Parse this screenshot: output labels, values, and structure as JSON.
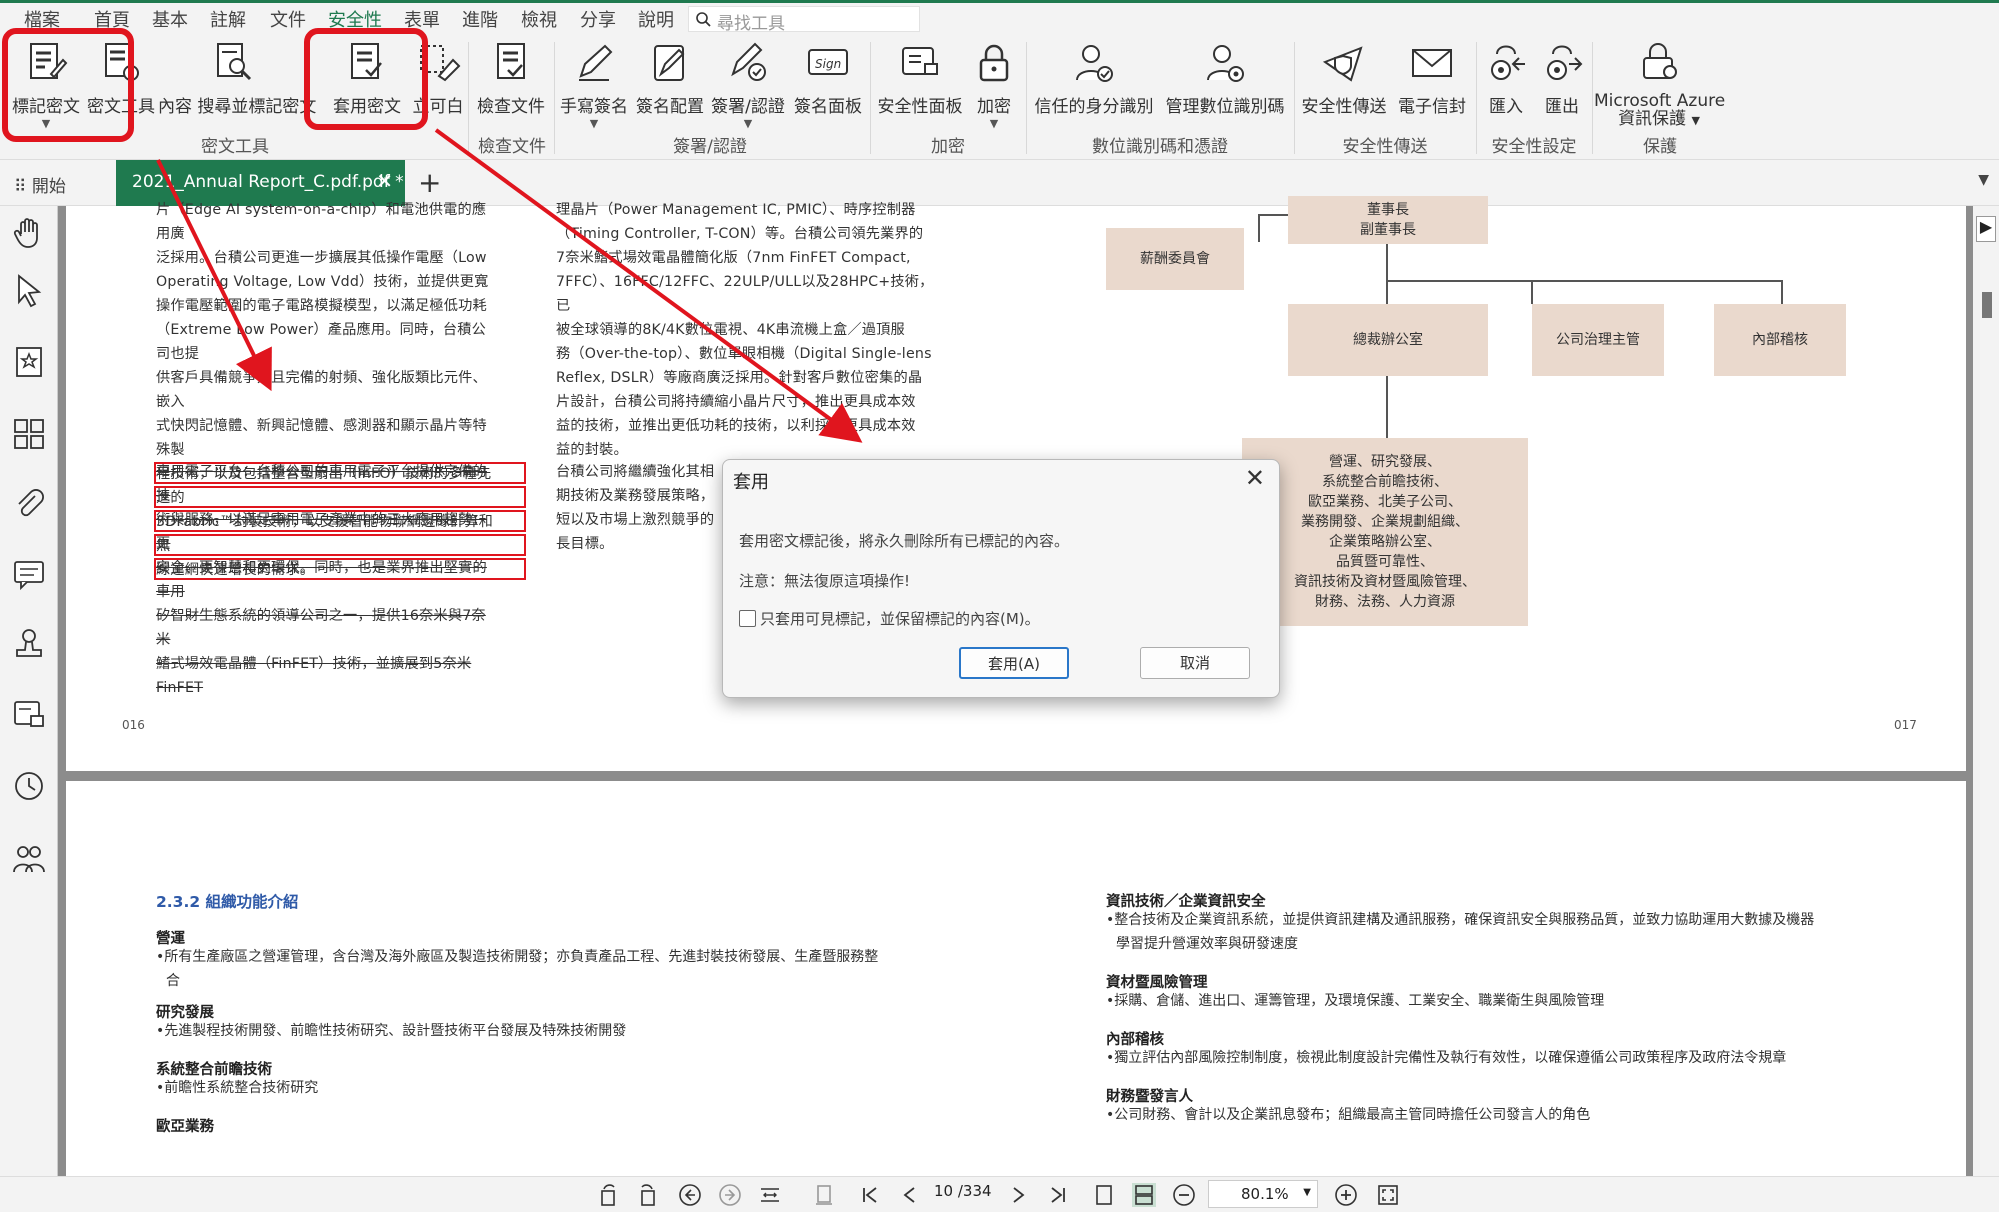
{
  "menu": [
    "檔案",
    "首頁",
    "基本",
    "註解",
    "文件",
    "安全性",
    "表單",
    "進階",
    "檢視",
    "分享",
    "說明"
  ],
  "search_placeholder": "尋找工具",
  "ribbon": {
    "buttons": {
      "mark": "標記密文",
      "redact_tools": "密文工具",
      "search_redact": "內容 搜尋並標記密文",
      "apply": "套用密文",
      "whiteout": "立可白",
      "inspect": "檢查文件",
      "handsign": "手寫簽名",
      "sign_config": "簽名配置",
      "sign_cert": "簽署/認證",
      "sign_panel": "簽名面板",
      "security_panel": "安全性面板",
      "encrypt": "加密",
      "trusted_ids": "信任的身分識別",
      "manage_ids": "管理數位識別碼",
      "secure_send": "安全性傳送",
      "email_sign": "電子信封",
      "import": "匯入",
      "export": "匯出",
      "azure1": "Microsoft Azure",
      "azure2": "資訊保護"
    },
    "groups": {
      "redact": "密文工具",
      "inspect": "檢查文件",
      "sign": "簽署/認證",
      "encrypt": "加密",
      "digital_id": "數位識別碼和憑證",
      "secure_send": "安全性傳送",
      "security_settings": "安全性設定",
      "protect": "保護"
    }
  },
  "tabs": {
    "start": "開始",
    "doc": "2021_Annual Report_C.pdf.pdf *"
  },
  "page1": {
    "left_col": [
      "片（Edge AI system-on-a-chip）和電池供電的應用廣",
      "泛採用。台積公司更進一步擴展其低操作電壓（Low",
      "Operating Voltage, Low Vdd）技術，並提供更寬",
      "操作電壓範圍的電子電路模擬模型，以滿足極低功耗",
      "（Extreme Low Power）產品應用。同時，台積公司也提",
      "供客戶具備競爭力且完備的射頻、強化版類比元件、嵌入",
      "式快閃記憶體、新興記憶體、感測器和顯示晶片等特殊製",
      "程技術，以及包括整合型扇出（InFO）技術的多種先進的",
      "3DFabric™封裝技術，以支援智能物聯網邊緣計算和無",
      "線連網快速增長的需求。"
    ],
    "left_redacted": [
      "車用電子平台：台積公司的車用電子平台提供完備的技",
      "術與服務，以滿足車用電子產業中的三大應用趨勢：更",
      "安全、更智慧和更環保。同時，也是業界推出堅實的車用",
      "矽智財生態系統的領導公司之一，提供16奈米與7奈米",
      "鰭式場效電晶體（FinFET）技術，並擴展到5奈米FinFET"
    ],
    "mid_col": [
      "理晶片（Power Management IC, PMIC）、時序控制器",
      "（Timing Controller, T-CON）等。台積公司領先業界的",
      "7奈米鰭式場效電晶體簡化版（7nm FinFET Compact,",
      "7FFC）、16FFC/12FFC、22ULP/ULL以及28HPC+技術，已",
      "被全球領導的8K/4K數位電視、4K串流機上盒／過頂服",
      "務（Over-the-top）、數位單眼相機（Digital Single-lens",
      "Reflex, DSLR）等廠商廣泛採用。針對客戶數位密集的晶",
      "片設計，台積公司將持續縮小晶片尺寸，推出更具成本效",
      "益的技術，並推出更低功耗的技術，以利採用更具成本效",
      "益的封裝。"
    ],
    "mid_col2": [
      "台積公司將繼續強化其相",
      "期技術及業務發展策略，",
      "短以及市場上激烈競爭的",
      "長目標。"
    ],
    "page_left": "016",
    "page_right": "017",
    "org": {
      "chair": "董事長\n副董事長",
      "comp": "薪酬委員會",
      "ceo": "總裁辦公室",
      "gov": "公司治理主管",
      "audit": "內部稽核",
      "ops": "營運、研究發展、\n系統整合前瞻技術、\n歐亞業務、北美子公司、\n業務開發、企業規劃組織、\n企業策略辦公室、\n品質暨可靠性、\n資訊技術及資材暨風險管理、\n財務、法務、人力資源"
    }
  },
  "dialog": {
    "title": "套用",
    "msg": "套用密文標記後，將永久刪除所有已標記的內容。",
    "warn": "注意：無法復原這項操作!",
    "check": "只套用可見標記，並保留標記的內容(M)。",
    "apply": "套用(A)",
    "cancel": "取消"
  },
  "page2": {
    "heading": "2.3.2 組織功能介紹",
    "left": [
      {
        "title": "營運",
        "text": "•所有生產廠區之營運管理，含台灣及海外廠區及製造技術開發；亦負責產品工程、先進封裝技術發展、生產暨服務整",
        "text2": "合"
      },
      {
        "title": "研究發展",
        "text": "•先進製程技術開發、前瞻性技術研究、設計暨技術平台發展及特殊技術開發",
        "text2": ""
      },
      {
        "title": "系統整合前瞻技術",
        "text": "•前瞻性系統整合技術研究",
        "text2": ""
      },
      {
        "title": "歐亞業務",
        "text": "",
        "text2": ""
      }
    ],
    "right": [
      {
        "title": "資訊技術／企業資訊安全",
        "text": "•整合技術及企業資訊系統，並提供資訊建構及通訊服務，確保資訊安全與服務品質，並致力協助運用大數據及機器",
        "text2": "學習提升營運效率與研發速度"
      },
      {
        "title": "資材暨風險管理",
        "text": "•採購、倉儲、進出口、運籌管理，及環境保護、工業安全、職業衛生與風險管理",
        "text2": ""
      },
      {
        "title": "內部稽核",
        "text": "•獨立評估內部風險控制制度，檢視此制度設計完備性及執行有效性，以確保遵循公司政策程序及政府法令規章",
        "text2": ""
      },
      {
        "title": "財務暨發言人",
        "text": "•公司財務、會計以及企業訊息發布；組織最高主管同時擔任公司發言人的角色",
        "text2": ""
      }
    ]
  },
  "status": {
    "page": "10 /334",
    "zoom": "80.1%"
  },
  "colors": {
    "accent": "#1f7a4f",
    "highlight": "#e0151e",
    "org_box": "#ead9cd"
  }
}
